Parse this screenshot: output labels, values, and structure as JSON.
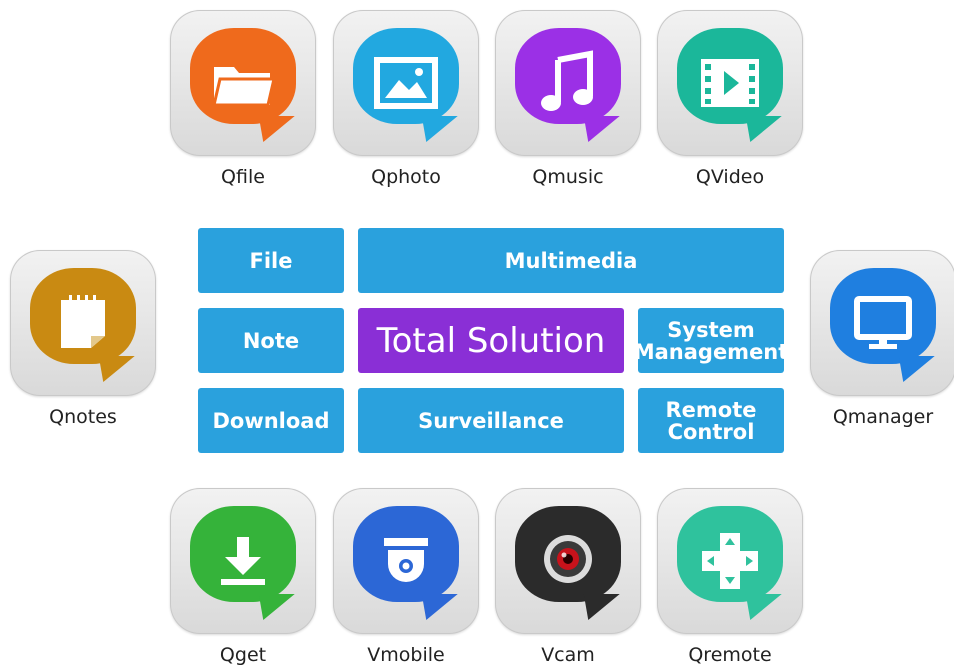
{
  "apps_top": [
    {
      "name": "Qfile",
      "color": "#ef6a1c",
      "icon": "folder-icon"
    },
    {
      "name": "Qphoto",
      "color": "#22a8e0",
      "icon": "photo-icon"
    },
    {
      "name": "Qmusic",
      "color": "#9b30e6",
      "icon": "music-note-icon"
    },
    {
      "name": "QVideo",
      "color": "#1bb79a",
      "icon": "film-icon"
    }
  ],
  "apps_side": [
    {
      "name": "Qnotes",
      "color": "#c98a12",
      "icon": "notepad-icon"
    },
    {
      "name": "Qmanager",
      "color": "#1f7fe0",
      "icon": "monitor-icon"
    }
  ],
  "apps_bottom": [
    {
      "name": "Qget",
      "color": "#35b33a",
      "icon": "download-icon"
    },
    {
      "name": "Vmobile",
      "color": "#2c67d6",
      "icon": "dome-camera-icon"
    },
    {
      "name": "Vcam",
      "color": "#2b2b2b",
      "icon": "webcam-icon"
    },
    {
      "name": "Qremote",
      "color": "#2fc29d",
      "icon": "dpad-icon"
    }
  ],
  "categories": {
    "file": "File",
    "multimedia": "Multimedia",
    "note": "Note",
    "total": "Total Solution",
    "system_line1": "System",
    "system_line2": "Management",
    "download": "Download",
    "surveillance": "Surveillance",
    "remote_line1": "Remote",
    "remote_line2": "Control"
  },
  "colors": {
    "category_blue": "#2aa1dd",
    "center_purple": "#8a2fd6"
  }
}
